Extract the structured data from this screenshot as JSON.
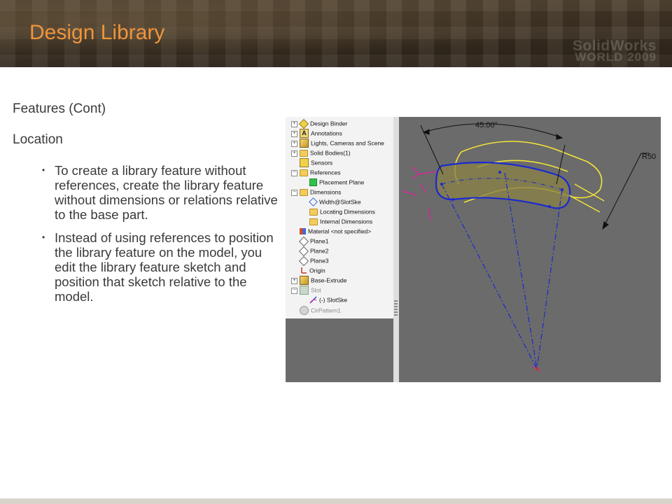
{
  "slide": {
    "title": "Design Library",
    "brand_line1": "SolidWorks",
    "brand_line2": "WORLD 2009"
  },
  "content": {
    "subtitle1": "Features (Cont)",
    "subtitle2": "Location",
    "bullets": [
      "To create a library feature without references, create the library feature without dimensions or relations relative to the base part.",
      "Instead of using references to position the library feature on the model, you edit the library feature sketch and position that sketch relative to the model."
    ]
  },
  "feature_tree": {
    "items": [
      {
        "label": "Design Binder",
        "icon": "design-binder-icon"
      },
      {
        "label": "Annotations",
        "icon": "annotations-icon"
      },
      {
        "label": "Lights, Cameras and Scene",
        "icon": "lights-icon"
      },
      {
        "label": "Solid Bodies(1)",
        "icon": "solid-bodies-icon"
      },
      {
        "label": "Sensors",
        "icon": "sensors-icon"
      },
      {
        "label": "References",
        "icon": "folder-icon"
      },
      {
        "label": "Placement Plane",
        "icon": "placement-plane-icon"
      },
      {
        "label": "Dimensions",
        "icon": "folder-icon"
      },
      {
        "label": "Width@SlotSke",
        "icon": "dimension-icon"
      },
      {
        "label": "Locating Dimensions",
        "icon": "folder-icon"
      },
      {
        "label": "Internal Dimensions",
        "icon": "folder-icon"
      },
      {
        "label": "Material <not specified>",
        "icon": "material-icon"
      },
      {
        "label": "Plane1",
        "icon": "plane-icon"
      },
      {
        "label": "Plane2",
        "icon": "plane-icon"
      },
      {
        "label": "Plane3",
        "icon": "plane-icon"
      },
      {
        "label": "Origin",
        "icon": "origin-icon"
      },
      {
        "label": "Base-Extrude",
        "icon": "extrude-icon"
      },
      {
        "label": "Slot",
        "icon": "slot-feature-icon"
      },
      {
        "label": "(-) SlotSke",
        "icon": "sketch-icon"
      },
      {
        "label": "CirPattern1",
        "icon": "pattern-icon"
      }
    ]
  },
  "viewport": {
    "angle_dimension": "45.00°",
    "radius_dimension": "R50"
  },
  "colors": {
    "title": "#f0943a",
    "sketch_blue": "#1a2ad0",
    "feature_yellow": "#f2e33a",
    "relation_magenta": "#e0209a",
    "viewport_bg": "#6b6b6b"
  }
}
